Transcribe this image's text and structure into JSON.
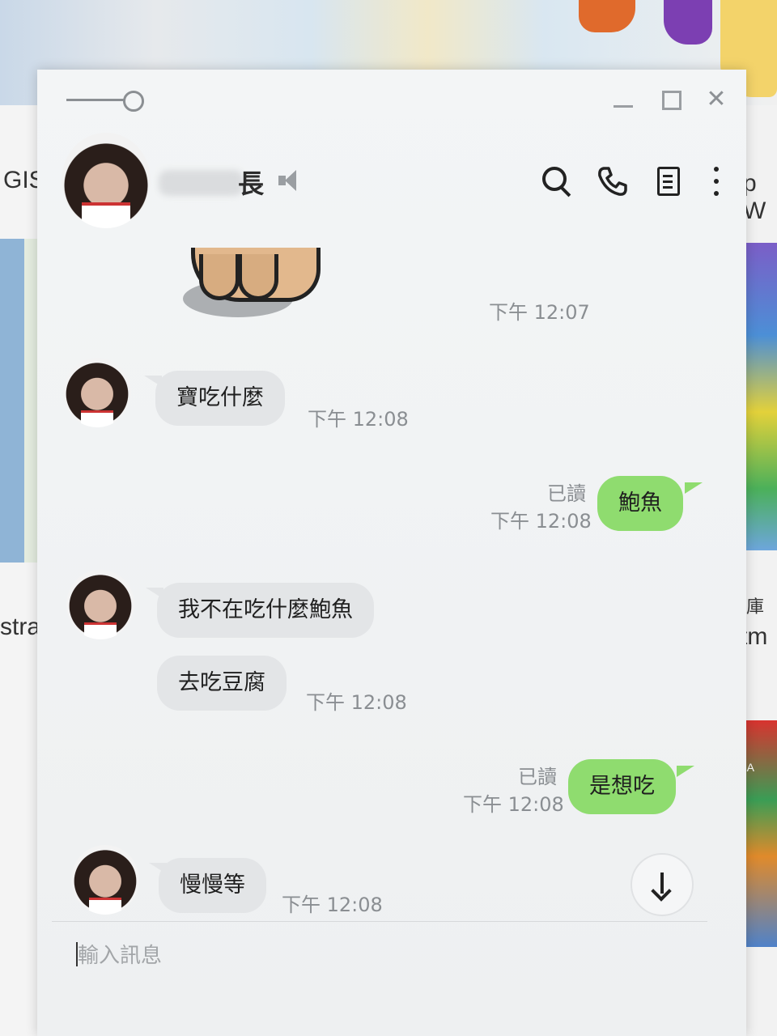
{
  "background": {
    "left_text_1": "GIS",
    "left_text_2": "strat",
    "right_text_1": "p W",
    "right_text_2": "有庫存",
    "right_text_3": "iftm",
    "map_label": "SSIA"
  },
  "header": {
    "contact_name": "長",
    "icons": [
      "search-icon",
      "phone-icon",
      "note-icon",
      "more-icon"
    ]
  },
  "messages": [
    {
      "type": "sticker",
      "direction": "out",
      "time": "下午 12:07"
    },
    {
      "type": "text",
      "direction": "in",
      "text": "寶吃什麼",
      "time": "下午 12:08"
    },
    {
      "type": "text",
      "direction": "out",
      "text": "鮑魚",
      "read": "已讀",
      "time": "下午 12:08"
    },
    {
      "type": "text",
      "direction": "in",
      "text": "我不在吃什麼鮑魚"
    },
    {
      "type": "text",
      "direction": "in",
      "text": "去吃豆腐",
      "time": "下午 12:08"
    },
    {
      "type": "text",
      "direction": "out",
      "text": "是想吃",
      "read": "已讀",
      "time": "下午 12:08"
    },
    {
      "type": "text",
      "direction": "in",
      "text": "慢慢等",
      "time": "下午 12:08"
    }
  ],
  "input": {
    "placeholder": "輸入訊息",
    "value": ""
  },
  "colors": {
    "outgoing_bubble": "#8fdc6f",
    "incoming_bubble": "#e3e5e7",
    "window_bg": "#f3f5f6"
  }
}
